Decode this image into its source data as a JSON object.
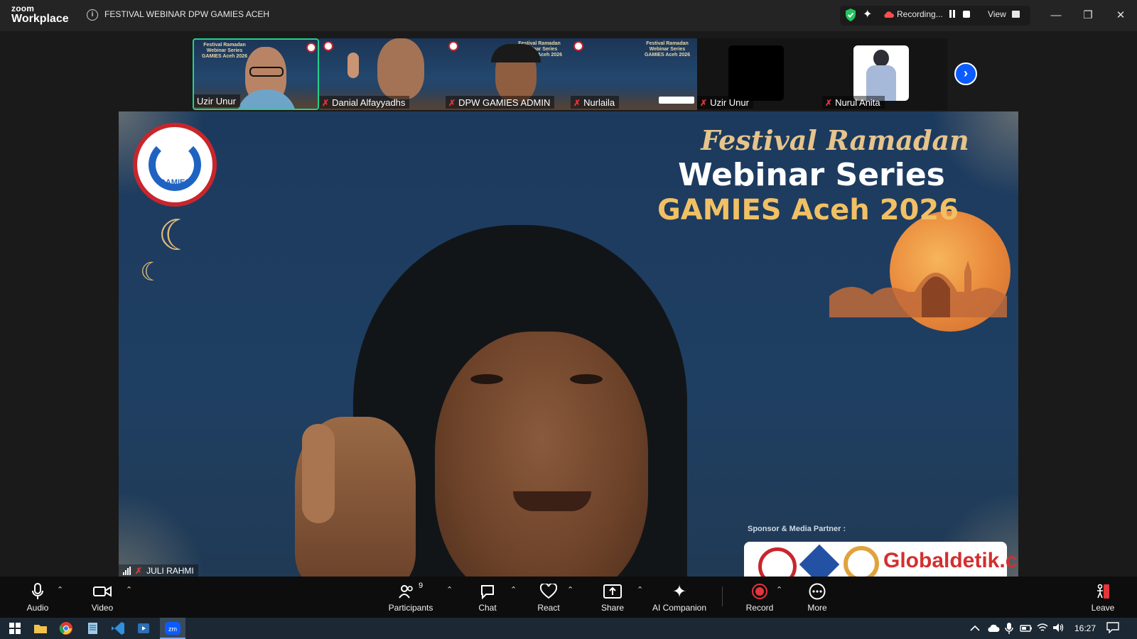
{
  "app": {
    "brand_line1": "zoom",
    "brand_line2": "Workplace",
    "meeting_title": "FESTIVAL WEBINAR DPW GAMIES ACEH"
  },
  "topbar": {
    "recording_label": "Recording...",
    "view_label": "View"
  },
  "participants_strip": [
    {
      "name": "Uzir Unur",
      "muted": false,
      "active_speaker": true,
      "type": "video"
    },
    {
      "name": "Danial Alfayyadhs",
      "muted": true,
      "type": "video"
    },
    {
      "name": "DPW GAMIES ADMIN",
      "muted": true,
      "type": "video"
    },
    {
      "name": "Nurlaila",
      "muted": true,
      "type": "video"
    },
    {
      "name": "Uzir Unur",
      "muted": true,
      "type": "avatar-black"
    },
    {
      "name": "Nurul Anita",
      "muted": true,
      "type": "avatar-white"
    }
  ],
  "slide": {
    "script_title": "Festival Ramadan",
    "title": "Webinar Series",
    "subtitle": "GAMIES Aceh 2026",
    "logo_text": "GAMIES",
    "sponsor_label": "Sponsor & Media Partner :",
    "sponsor_text": "Globaldetik.com"
  },
  "mini_slide": {
    "line1": "Festival Ramadan",
    "line2": "Webinar Series",
    "line3": "GAMIES Aceh 2026"
  },
  "main_speaker": {
    "name": "JULI RAHMI",
    "muted": true
  },
  "toolbar": {
    "audio": "Audio",
    "video": "Video",
    "participants": "Participants",
    "participants_count": "9",
    "chat": "Chat",
    "react": "React",
    "share": "Share",
    "ai_companion": "AI Companion",
    "record": "Record",
    "more": "More",
    "leave": "Leave"
  },
  "taskbar": {
    "time": "16:27"
  },
  "colors": {
    "accent_blue": "#0b5cff",
    "active_border": "#23d18b",
    "record_red": "#e5343b",
    "slide_bg": "#1d3a5b",
    "slide_gold": "#f2c064"
  }
}
